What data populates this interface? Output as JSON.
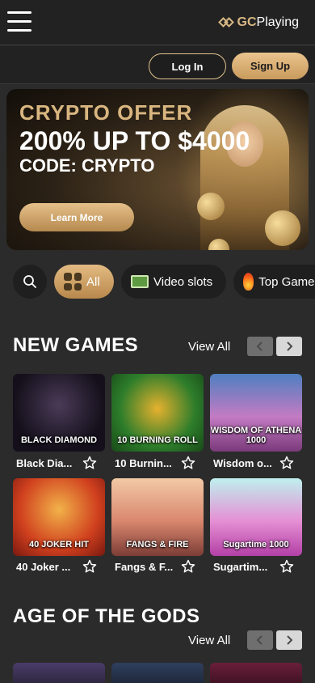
{
  "header": {
    "logo_text_brand": "GC",
    "logo_text_rest": "Playing"
  },
  "auth": {
    "login_label": "Log In",
    "signup_label": "Sign Up"
  },
  "banner": {
    "kicker": "CRYPTO OFFER",
    "headline": "200% UP TO $4000",
    "code": "CODE: CRYPTO",
    "cta": "Learn More"
  },
  "filters": [
    {
      "label": "All",
      "icon": "grid-icon",
      "active": true
    },
    {
      "label": "Video slots",
      "icon": "slot-machine-icon",
      "active": false
    },
    {
      "label": "Top Games",
      "icon": "fire-icon",
      "active": false
    }
  ],
  "sections": [
    {
      "title": "NEW GAMES",
      "view_all": "View All",
      "games": [
        {
          "tile_text": "BLACK DIAMOND",
          "caption": "Black Dia..."
        },
        {
          "tile_text": "10 BURNING ROLL",
          "caption": "10 Burnin..."
        },
        {
          "tile_text": "WISDOM OF ATHENA 1000",
          "caption": "Wisdom o..."
        },
        {
          "tile_text": "40 JOKER HIT",
          "caption": "40 Joker ..."
        },
        {
          "tile_text": "FANGS & FIRE",
          "caption": "Fangs & F..."
        },
        {
          "tile_text": "Sugartime 1000",
          "caption": "Sugartim..."
        }
      ]
    },
    {
      "title": "AGE OF THE GODS",
      "view_all": "View All"
    }
  ],
  "colors": {
    "background": "#2b2b2b",
    "topbar": "#222222",
    "accent_gold": "#e2c28e"
  }
}
